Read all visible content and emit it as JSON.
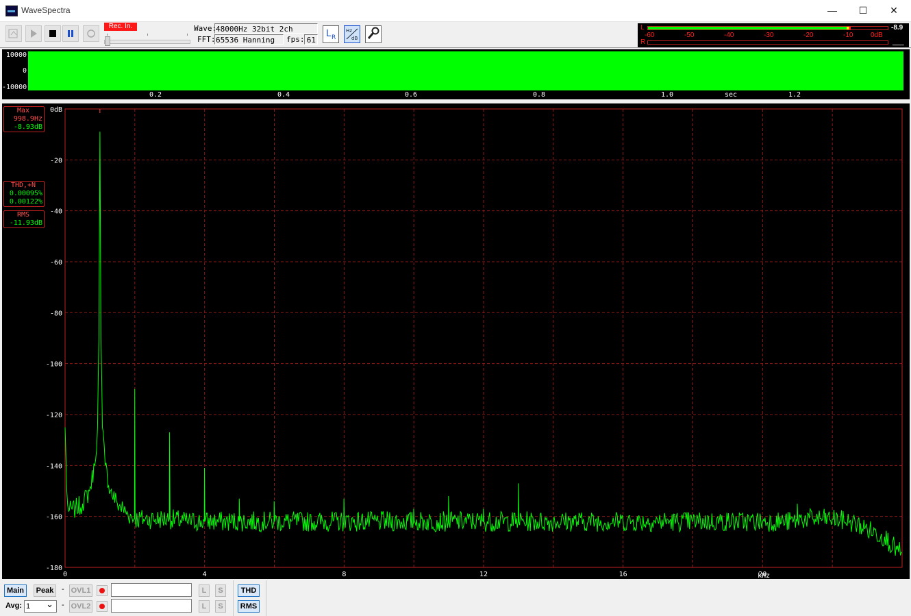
{
  "window": {
    "title": "WaveSpectra",
    "minimize": "—",
    "maximize": "☐",
    "close": "✕"
  },
  "toolbar": {
    "rec_input": "Rec. In.",
    "wave_label": "Wave:",
    "wave_value": "48000Hz 32bit 2ch",
    "fft_label": "FFT:",
    "fft_value": "65536 Hanning",
    "fps_label": "fps:",
    "fps_value": "61",
    "lr_label": "LR",
    "hzdb_label": "Hz dB"
  },
  "level_meter": {
    "left_channel": "L",
    "right_channel": "R",
    "scale": [
      "-60",
      "-50",
      "-40",
      "-30",
      "-20",
      "-10",
      "0dB"
    ],
    "left_readout": "-8.9",
    "right_readout": "___",
    "left_level_db": -8.9,
    "colors": {
      "green": "#00ff00",
      "yellow": "#ffff00",
      "red": "#ff2020"
    }
  },
  "waveform": {
    "y_labels": [
      "10000",
      "0",
      "-10000"
    ],
    "x_labels": [
      "0.2",
      "0.4",
      "0.6",
      "0.8",
      "1.0",
      "1.2"
    ],
    "x_unit": "sec",
    "fill_color": "#00ff00"
  },
  "readouts": {
    "max_label": "Max",
    "max_freq": "998.9Hz",
    "max_level": "-8.93dB",
    "thd_label": "THD,+N",
    "thd_value": "0.00095%",
    "thdn_value": "0.00122%",
    "rms_label": "RMS",
    "rms_value": "-11.93dB"
  },
  "chart_data": {
    "type": "line",
    "xlabel": "kHz",
    "ylabel": "",
    "x_ticks": [
      "0",
      "4",
      "8",
      "12",
      "16",
      "20"
    ],
    "y_ticks": [
      "0dB",
      "-20",
      "-40",
      "-60",
      "-80",
      "-100",
      "-120",
      "-140",
      "-160",
      "-180"
    ],
    "xlim": [
      0,
      24
    ],
    "ylim": [
      -180,
      0
    ],
    "grid": true,
    "line_color": "#00ff00",
    "series": [
      {
        "x": [
          0,
          0.05,
          0.1,
          0.3,
          0.5,
          0.7,
          0.85,
          0.93,
          0.97,
          0.999,
          1.03,
          1.07,
          1.15,
          1.3,
          1.5,
          1.8,
          1.99,
          1.998,
          2.01,
          2.3,
          2.99,
          2.997,
          3.01,
          3.5,
          3.99,
          3.996,
          4.01,
          4.5,
          4.99,
          4.995,
          5.01,
          5.99,
          5.995,
          6.01,
          7.0,
          7.99,
          7.995,
          8.01,
          9.0,
          9.99,
          9.995,
          10.01,
          10.99,
          10.995,
          11.01,
          11.99,
          11.995,
          12.01,
          12.99,
          12.995,
          13.01,
          14.0,
          15.0,
          16.0,
          17.0,
          18.0,
          19.0,
          20.0,
          20.99,
          20.995,
          21.01,
          22.0,
          22.5,
          23.0,
          23.5,
          23.9,
          24.0
        ],
        "y": [
          -125,
          -150,
          -158,
          -157,
          -155,
          -150,
          -140,
          -125,
          -90,
          -8.9,
          -90,
          -125,
          -140,
          -150,
          -155,
          -159,
          -161,
          -110,
          -161,
          -161,
          -161,
          -127,
          -161,
          -162,
          -162,
          -141,
          -162,
          -162,
          -162,
          -153,
          -162,
          -162,
          -154,
          -162,
          -162,
          -162,
          -153,
          -162,
          -162,
          -162,
          -157,
          -162,
          -162,
          -152,
          -162,
          -162,
          -157,
          -162,
          -162,
          -147,
          -162,
          -162,
          -162,
          -162,
          -162,
          -162,
          -162,
          -162,
          -162,
          -155,
          -161,
          -161,
          -162,
          -165,
          -168,
          -174,
          -174
        ]
      }
    ]
  },
  "bottom_bar": {
    "main_label": "Main",
    "peak_label": "Peak",
    "ovl1_label": "OVL1",
    "ovl2_label": "OVL2",
    "avg_label": "Avg:",
    "avg_value": "1",
    "l_label": "L",
    "s_label": "S",
    "thd_label": "THD",
    "rms_label": "RMS",
    "dash": "-"
  }
}
